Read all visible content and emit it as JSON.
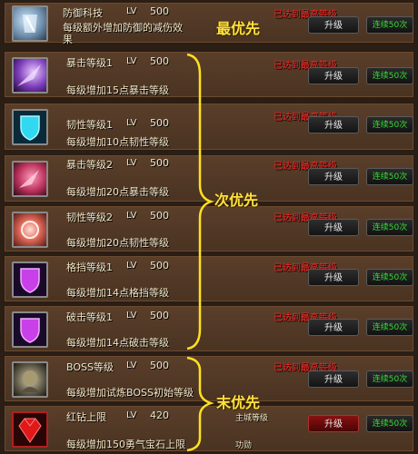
{
  "common": {
    "lv_label": "LV",
    "upgrade_label": "升级",
    "upgrade50_label": "连续50次",
    "maxed_text": "已达到最高等级"
  },
  "tiers": {
    "top": "最优先",
    "mid": "次优先",
    "last": "末优先"
  },
  "skills": [
    {
      "name": "防御科技",
      "level": "500",
      "desc_line1": "每级额外增加防御的减伤效",
      "desc_line2": "果"
    },
    {
      "name": "暴击等级1",
      "level": "500",
      "desc": "每级增加15点暴击等级"
    },
    {
      "name": "韧性等级1",
      "level": "500",
      "desc": "每级增加10点韧性等级"
    },
    {
      "name": "暴击等级2",
      "level": "500",
      "desc": "每级增加20点暴击等级"
    },
    {
      "name": "韧性等级2",
      "level": "500",
      "desc": "每级增加20点韧性等级"
    },
    {
      "name": "格挡等级1",
      "level": "500",
      "desc": "每级增加14点格挡等级"
    },
    {
      "name": "破击等级1",
      "level": "500",
      "desc": "每级增加14点破击等级"
    },
    {
      "name": "BOSS等级",
      "level": "500",
      "desc": "每级增加试炼BOSS初始等级"
    },
    {
      "name": "红钻上限",
      "level": "420",
      "desc": "每级增加150勇气宝石上限",
      "req1_label": "主城等级",
      "req2_label": "功勋"
    }
  ],
  "colors": {
    "tier_text": "#ffe040",
    "maxed": "#ff2020",
    "upgrade50": "#33dd33"
  }
}
